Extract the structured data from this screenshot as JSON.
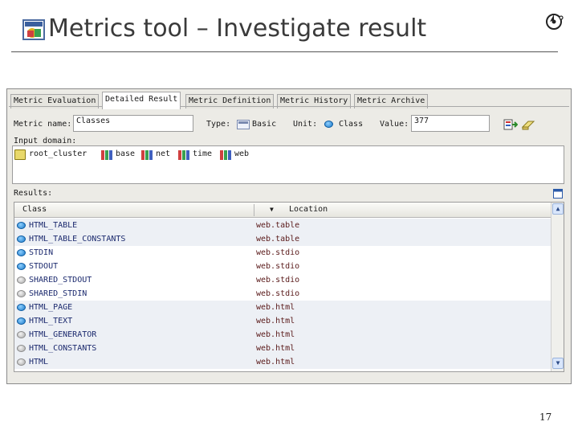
{
  "slide": {
    "title": "Metrics tool – Investigate result",
    "page_number": "17"
  },
  "tabs": [
    {
      "label": "Metric Evaluation",
      "active": false
    },
    {
      "label": "Detailed Result",
      "active": true
    },
    {
      "label": "Metric Definition",
      "active": false
    },
    {
      "label": "Metric History",
      "active": false
    },
    {
      "label": "Metric Archive",
      "active": false
    }
  ],
  "metric": {
    "name_label": "Metric name:",
    "name_value": "Classes",
    "type_label": "Type:",
    "type_value": "Basic",
    "unit_label": "Unit:",
    "unit_value": "Class",
    "value_label": "Value:",
    "value_value": "377"
  },
  "input_domain": {
    "label": "Input domain:",
    "items": [
      "root_cluster",
      "base",
      "net",
      "time",
      "web"
    ]
  },
  "results": {
    "label": "Results:",
    "columns": [
      "Class",
      "Location"
    ],
    "rows": [
      {
        "class": "HTML_TABLE",
        "location": "web.table",
        "dot": "blue",
        "shaded": true
      },
      {
        "class": "HTML_TABLE_CONSTANTS",
        "location": "web.table",
        "dot": "blue",
        "shaded": true
      },
      {
        "class": "STDIN",
        "location": "web.stdio",
        "dot": "blue",
        "shaded": false
      },
      {
        "class": "STDOUT",
        "location": "web.stdio",
        "dot": "blue",
        "shaded": false
      },
      {
        "class": "SHARED_STDOUT",
        "location": "web.stdio",
        "dot": "gray",
        "shaded": false
      },
      {
        "class": "SHARED_STDIN",
        "location": "web.stdio",
        "dot": "gray",
        "shaded": false
      },
      {
        "class": "HTML_PAGE",
        "location": "web.html",
        "dot": "blue",
        "shaded": true
      },
      {
        "class": "HTML_TEXT",
        "location": "web.html",
        "dot": "blue",
        "shaded": true
      },
      {
        "class": "HTML_GENERATOR",
        "location": "web.html",
        "dot": "gray",
        "shaded": true
      },
      {
        "class": "HTML_CONSTANTS",
        "location": "web.html",
        "dot": "gray",
        "shaded": true
      },
      {
        "class": "HTML",
        "location": "web.html",
        "dot": "gray",
        "shaded": true
      }
    ]
  },
  "icons": {
    "title_logo": "app-logo-icon",
    "corner_logo": "eiffel-logo-icon",
    "run": "run-metric-icon",
    "clear": "eraser-icon",
    "type": "type-icon",
    "unit": "unit-class-icon",
    "package": "cluster-icon",
    "maximize": "maximize-icon"
  },
  "colors": {
    "window_bg": "#ecebe6",
    "row_shaded": "#edf0f5",
    "class_text": "#1c2a6e",
    "location_text": "#5a1a1a",
    "dot_blue": "#1a78c8"
  }
}
